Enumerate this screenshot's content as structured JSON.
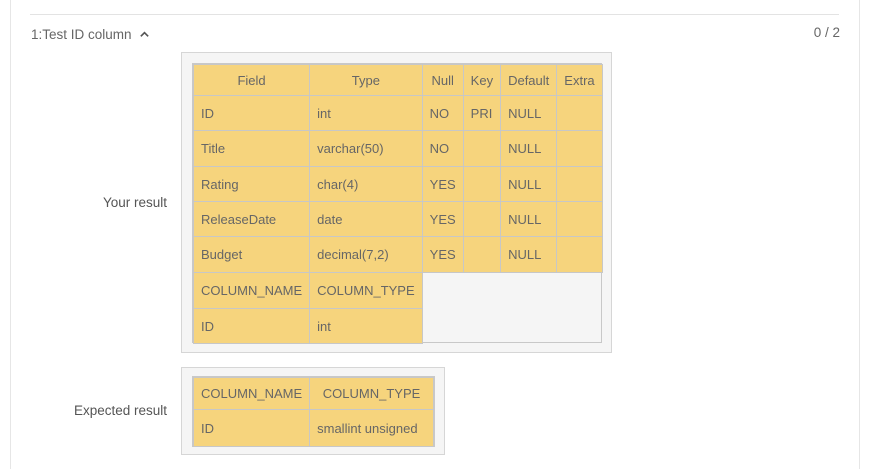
{
  "test": {
    "title": "1:Test ID column",
    "score": "0 / 2"
  },
  "your_result": {
    "label": "Your result",
    "describe": {
      "headers": [
        "Field",
        "Type",
        "Null",
        "Key",
        "Default",
        "Extra"
      ],
      "rows": [
        [
          "ID",
          "int",
          "NO",
          "PRI",
          "NULL",
          ""
        ],
        [
          "Title",
          "varchar(50)",
          "NO",
          "",
          "NULL",
          ""
        ],
        [
          "Rating",
          "char(4)",
          "YES",
          "",
          "NULL",
          ""
        ],
        [
          "ReleaseDate",
          "date",
          "YES",
          "",
          "NULL",
          ""
        ],
        [
          "Budget",
          "decimal(7,2)",
          "YES",
          "",
          "NULL",
          ""
        ]
      ]
    },
    "columns": {
      "headers": [
        "COLUMN_NAME",
        "COLUMN_TYPE"
      ],
      "rows": [
        [
          "ID",
          "int"
        ]
      ]
    }
  },
  "expected_result": {
    "label": "Expected result",
    "columns": {
      "headers": [
        "COLUMN_NAME",
        "COLUMN_TYPE"
      ],
      "rows": [
        [
          "ID",
          "smallint unsigned"
        ]
      ]
    }
  },
  "icons": {
    "toggle": "chevron-up-icon"
  },
  "colors": {
    "cell": "#f6d47d",
    "panel": "#f5f5f5"
  }
}
